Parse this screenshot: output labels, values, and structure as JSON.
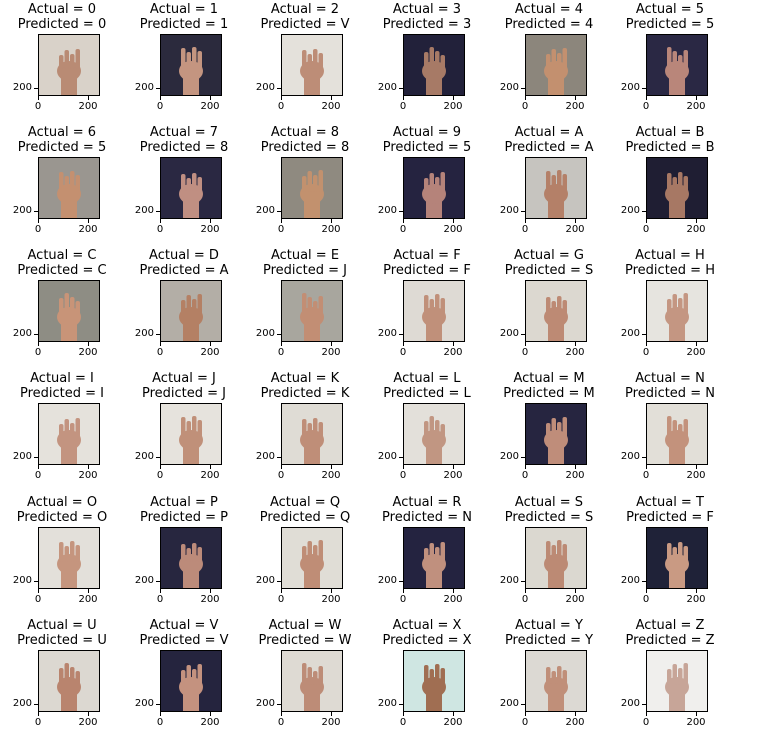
{
  "chart_data": {
    "type": "image-grid",
    "rows": 6,
    "cols": 6,
    "tick_labels": {
      "x": [
        "0",
        "200"
      ],
      "y": [
        "200"
      ]
    },
    "panels": [
      {
        "actual": "Actual = 0",
        "predicted": "Predicted = 0",
        "bg": "#d9d2c9",
        "skin": "#b98b74"
      },
      {
        "actual": "Actual = 1",
        "predicted": "Predicted = 1",
        "bg": "#2b2a3d",
        "skin": "#c49580"
      },
      {
        "actual": "Actual = 2",
        "predicted": "Predicted = V",
        "bg": "#e4e1db",
        "skin": "#bd8d77"
      },
      {
        "actual": "Actual = 3",
        "predicted": "Predicted = 3",
        "bg": "#22213a",
        "skin": "#a77a66"
      },
      {
        "actual": "Actual = 4",
        "predicted": "Predicted = 4",
        "bg": "#8c867c",
        "skin": "#c3906f"
      },
      {
        "actual": "Actual = 5",
        "predicted": "Predicted = 5",
        "bg": "#2a2844",
        "skin": "#b9867a"
      },
      {
        "actual": "Actual = 6",
        "predicted": "Predicted = 5",
        "bg": "#9a9690",
        "skin": "#c49070"
      },
      {
        "actual": "Actual = 7",
        "predicted": "Predicted = 8",
        "bg": "#2a2842",
        "skin": "#c08f82"
      },
      {
        "actual": "Actual = 8",
        "predicted": "Predicted = 8",
        "bg": "#8f8a80",
        "skin": "#c2916e"
      },
      {
        "actual": "Actual = 9",
        "predicted": "Predicted = 5",
        "bg": "#252340",
        "skin": "#b5837a"
      },
      {
        "actual": "Actual = A",
        "predicted": "Predicted = A",
        "bg": "#c6c4bf",
        "skin": "#b48068"
      },
      {
        "actual": "Actual = B",
        "predicted": "Predicted = B",
        "bg": "#1f1e33",
        "skin": "#a77864"
      },
      {
        "actual": "Actual = C",
        "predicted": "Predicted = C",
        "bg": "#8e8d84",
        "skin": "#c89478"
      },
      {
        "actual": "Actual = D",
        "predicted": "Predicted = A",
        "bg": "#b3aea6",
        "skin": "#b48064"
      },
      {
        "actual": "Actual = E",
        "predicted": "Predicted = J",
        "bg": "#a8a69e",
        "skin": "#c28e74"
      },
      {
        "actual": "Actual = F",
        "predicted": "Predicted = F",
        "bg": "#dedad4",
        "skin": "#c0907a"
      },
      {
        "actual": "Actual = G",
        "predicted": "Predicted = S",
        "bg": "#dcd8d0",
        "skin": "#bd8a74"
      },
      {
        "actual": "Actual = H",
        "predicted": "Predicted = H",
        "bg": "#e6e4df",
        "skin": "#c49682"
      },
      {
        "actual": "Actual = I",
        "predicted": "Predicted = I",
        "bg": "#e5e2dc",
        "skin": "#c39480"
      },
      {
        "actual": "Actual = J",
        "predicted": "Predicted = J",
        "bg": "#e6e3dd",
        "skin": "#c09079"
      },
      {
        "actual": "Actual = K",
        "predicted": "Predicted = K",
        "bg": "#dfdcd5",
        "skin": "#bf8e78"
      },
      {
        "actual": "Actual = L",
        "predicted": "Predicted = L",
        "bg": "#e3e0da",
        "skin": "#c19682"
      },
      {
        "actual": "Actual = M",
        "predicted": "Predicted = M",
        "bg": "#262540",
        "skin": "#bf8d7a"
      },
      {
        "actual": "Actual = N",
        "predicted": "Predicted = N",
        "bg": "#e2dfd8",
        "skin": "#c3927c"
      },
      {
        "actual": "Actual = O",
        "predicted": "Predicted = O",
        "bg": "#e3e0da",
        "skin": "#c5957e"
      },
      {
        "actual": "Actual = P",
        "predicted": "Predicted = P",
        "bg": "#27263f",
        "skin": "#bc8b7a"
      },
      {
        "actual": "Actual = Q",
        "predicted": "Predicted = Q",
        "bg": "#e0ddd6",
        "skin": "#bf8d76"
      },
      {
        "actual": "Actual = R",
        "predicted": "Predicted = N",
        "bg": "#242340",
        "skin": "#c0907e"
      },
      {
        "actual": "Actual = S",
        "predicted": "Predicted = S",
        "bg": "#dbd8d0",
        "skin": "#bc8a74"
      },
      {
        "actual": "Actual = T",
        "predicted": "Predicted = F",
        "bg": "#1f2238",
        "skin": "#c99a83"
      },
      {
        "actual": "Actual = U",
        "predicted": "Predicted = U",
        "bg": "#dcd8d1",
        "skin": "#b9846e"
      },
      {
        "actual": "Actual = V",
        "predicted": "Predicted = V",
        "bg": "#25243e",
        "skin": "#c4927f"
      },
      {
        "actual": "Actual = W",
        "predicted": "Predicted = W",
        "bg": "#dedad3",
        "skin": "#bd8c77"
      },
      {
        "actual": "Actual = X",
        "predicted": "Predicted = X",
        "bg": "#cfe6e2",
        "skin": "#a06e52"
      },
      {
        "actual": "Actual = Y",
        "predicted": "Predicted = Y",
        "bg": "#dcd9d3",
        "skin": "#c08f79"
      },
      {
        "actual": "Actual = Z",
        "predicted": "Predicted = Z",
        "bg": "#f0efed",
        "skin": "#c7a598"
      }
    ]
  }
}
